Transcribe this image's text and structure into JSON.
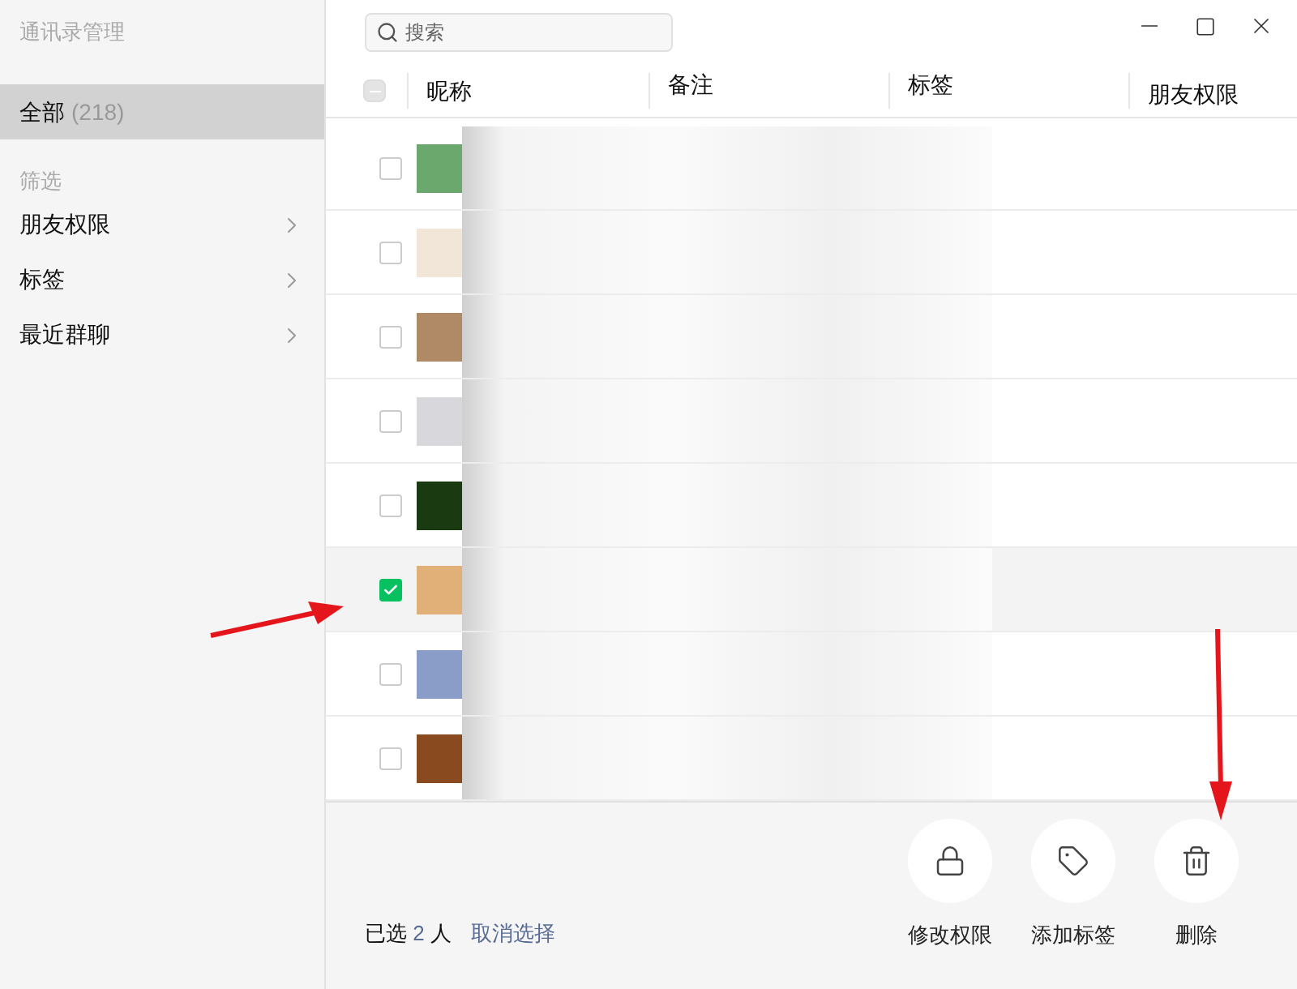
{
  "window": {
    "title": "通讯录管理"
  },
  "sidebar": {
    "all": {
      "label": "全部",
      "count": "(218)",
      "selected": true
    },
    "section": "筛选",
    "filters": [
      {
        "label": "朋友权限",
        "selected": false
      },
      {
        "label": "标签",
        "selected": false
      },
      {
        "label": "最近群聊",
        "selected": false
      }
    ]
  },
  "search": {
    "placeholder": "搜索"
  },
  "table": {
    "select_all": {
      "indeterminate": true
    },
    "columns": [
      "昵称",
      "备注",
      "标签",
      "朋友权限"
    ],
    "rows": [
      {
        "checked": false,
        "selected": false
      },
      {
        "checked": false,
        "selected": false
      },
      {
        "checked": false,
        "selected": false
      },
      {
        "checked": false,
        "selected": false
      },
      {
        "checked": false,
        "selected": false
      },
      {
        "checked": true,
        "selected": true
      },
      {
        "checked": false,
        "selected": false
      },
      {
        "checked": false,
        "selected": false
      }
    ]
  },
  "footer": {
    "selected_prefix": "已选",
    "selected_count": "2",
    "selected_suffix": "人",
    "clear": "取消选择",
    "actions": [
      {
        "kind": "lock",
        "label": "修改权限"
      },
      {
        "kind": "tag",
        "label": "添加标签"
      },
      {
        "kind": "trash",
        "label": "删除"
      }
    ]
  }
}
